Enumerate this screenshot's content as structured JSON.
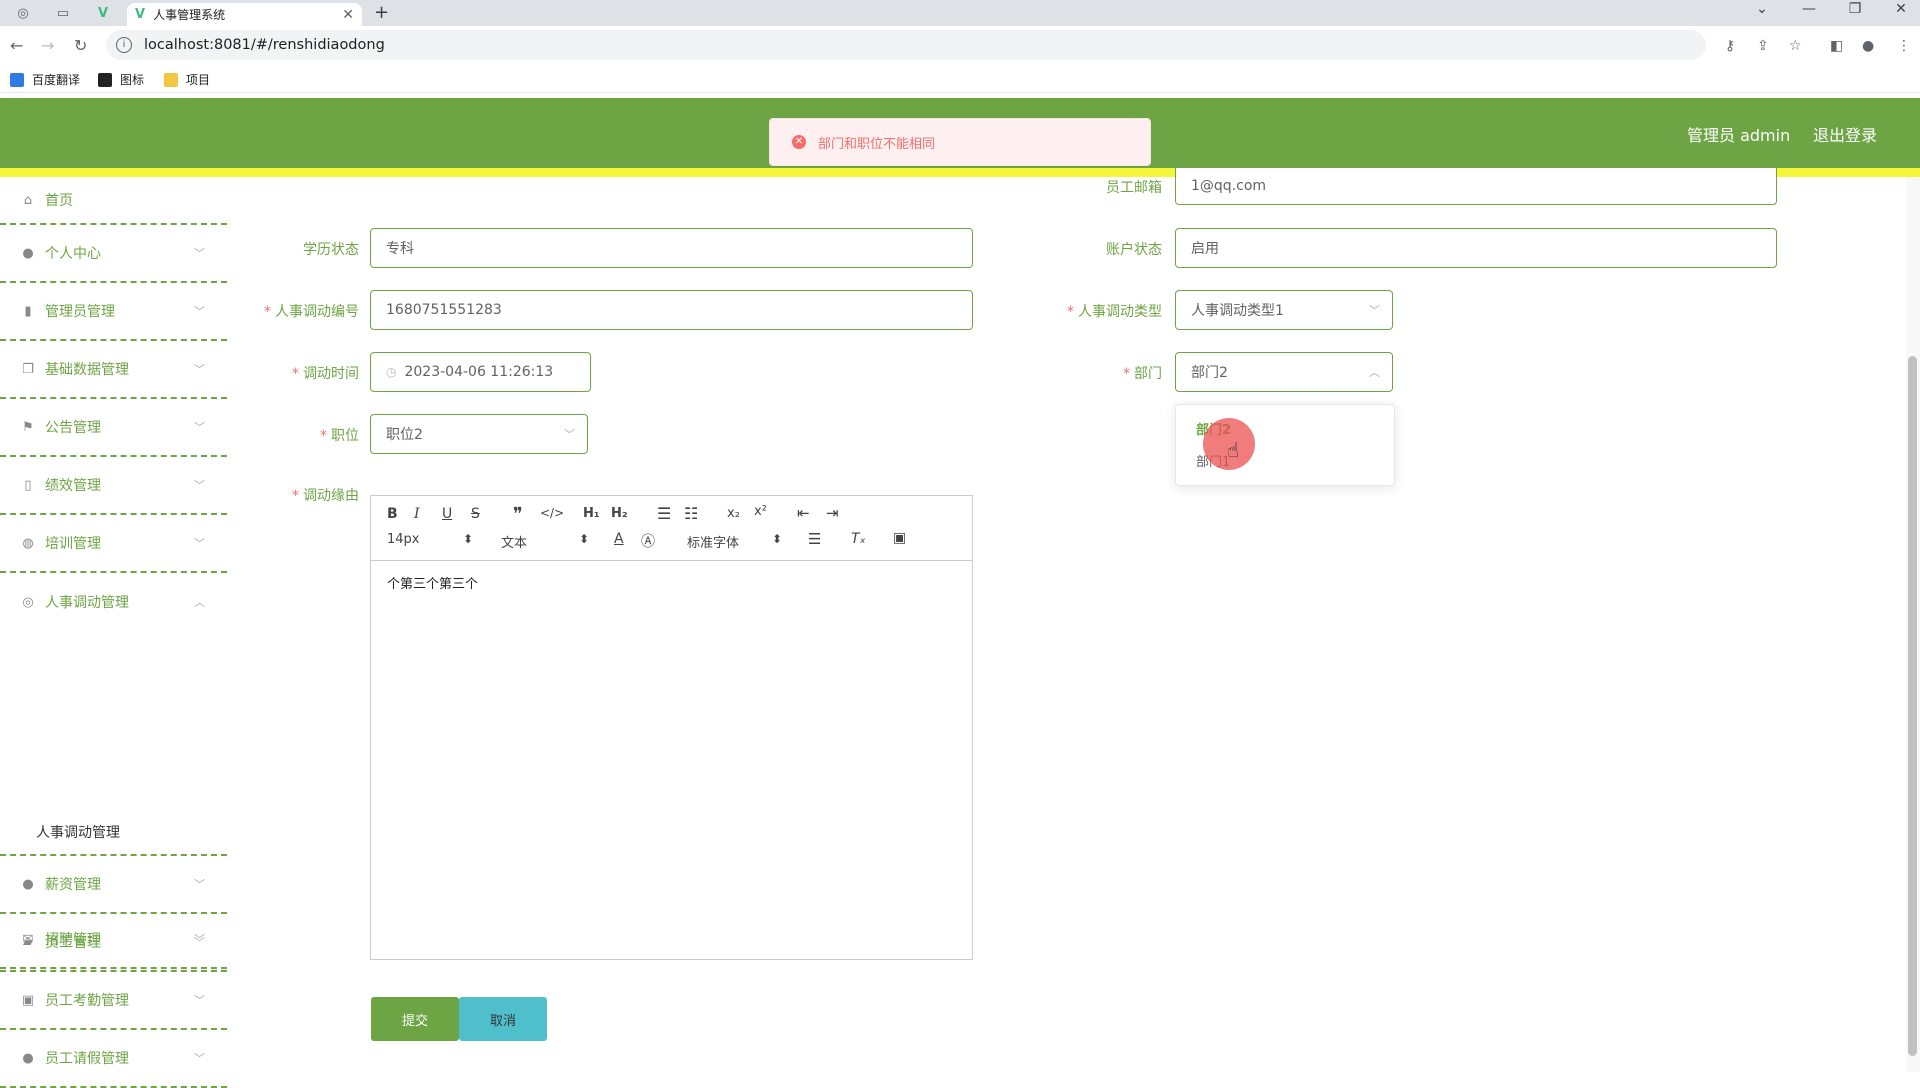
{
  "browser": {
    "tab_title": "人事管理系统",
    "url": "localhost:8081/#/renshidiaodong",
    "bookmarks": [
      "百度翻译",
      "图标",
      "项目"
    ]
  },
  "header": {
    "user_label": "管理员 admin",
    "logout": "退出登录"
  },
  "toast": {
    "message": "部门和职位不能相同",
    "type": "error"
  },
  "sidebar": {
    "items": [
      {
        "label": "首页",
        "icon": "home-icon"
      },
      {
        "label": "个人中心",
        "icon": "user-icon"
      },
      {
        "label": "管理员管理",
        "icon": "chart-icon"
      },
      {
        "label": "基础数据管理",
        "icon": "copy-icon"
      },
      {
        "label": "公告管理",
        "icon": "flag-icon"
      },
      {
        "label": "绩效管理",
        "icon": "battery-icon"
      },
      {
        "label": "培训管理",
        "icon": "globe-icon"
      },
      {
        "label": "人事调动管理",
        "icon": "life-ring-icon"
      },
      {
        "label": "薪资管理",
        "icon": "balloon-icon"
      },
      {
        "label": "员工管理",
        "icon": "ticket-icon"
      },
      {
        "label": "员工考勤管理",
        "icon": "clipboard-icon"
      },
      {
        "label": "员工请假管理",
        "icon": "person-icon"
      },
      {
        "label": "招聘管理",
        "icon": "mail-icon"
      }
    ],
    "active_sub": "人事调动管理"
  },
  "form": {
    "email_label": "员工邮箱",
    "email_value": "1@qq.com",
    "edu_label": "学历状态",
    "edu_value": "专科",
    "account_label": "账户状态",
    "account_value": "启用",
    "code_label": "人事调动编号",
    "code_value": "1680751551283",
    "type_label": "人事调动类型",
    "type_value": "人事调动类型1",
    "time_label": "调动时间",
    "time_value": "2023-04-06 11:26:13",
    "dept_label": "部门",
    "dept_value": "部门2",
    "position_label": "职位",
    "position_value": "职位2",
    "reason_label": "调动缘由",
    "reason_value": "个第三个第三个",
    "dept_options": [
      "部门2",
      "部门1"
    ]
  },
  "editor": {
    "font_size": "14px",
    "block_type": "文本",
    "font_family": "标准字体"
  },
  "buttons": {
    "submit": "提交",
    "cancel": "取消"
  },
  "colors": {
    "brand": "#6ea544",
    "accent_yellow": "#f5f53c",
    "cancel": "#4fbfcc",
    "error": "#f56c6c"
  }
}
